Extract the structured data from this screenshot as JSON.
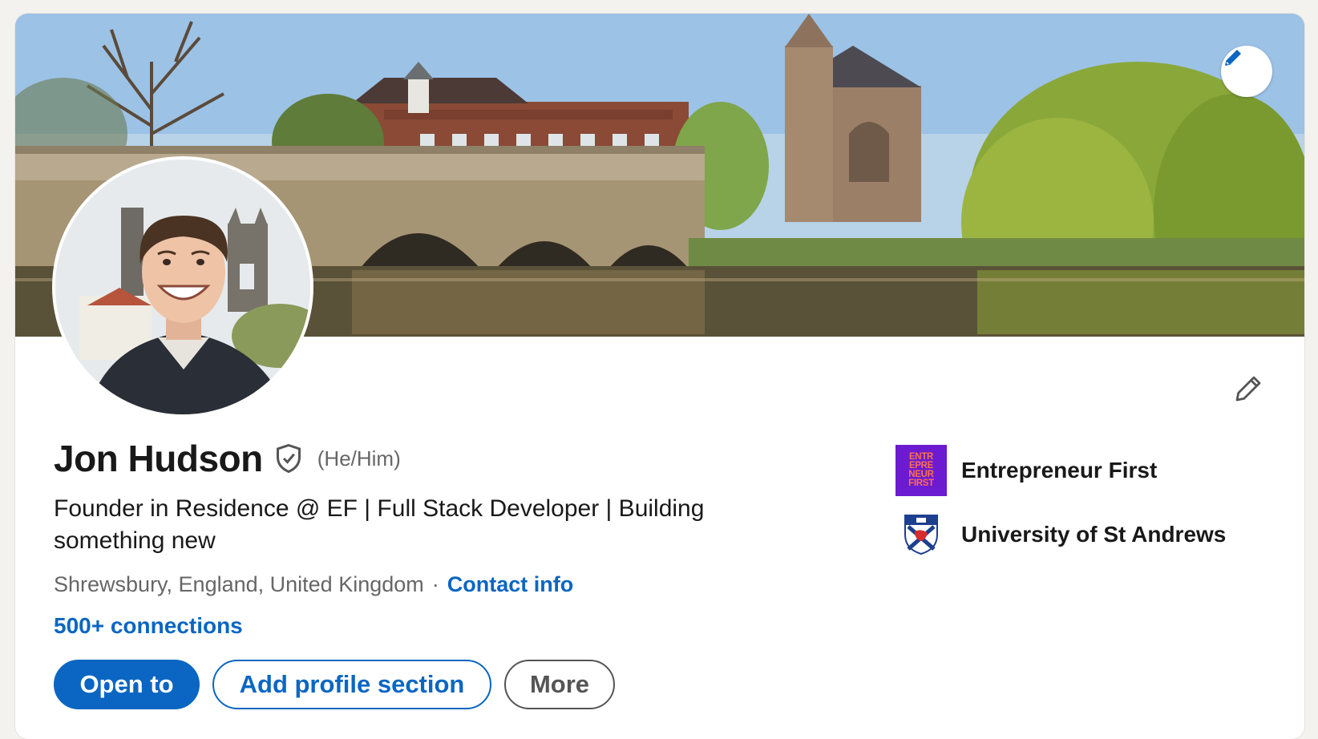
{
  "profile": {
    "name": "Jon Hudson",
    "pronouns": "(He/Him)",
    "headline": "Founder in Residence @ EF | Full Stack Developer | Building something new",
    "location": "Shrewsbury, England, United Kingdom",
    "separator": "·",
    "contact_info_label": "Contact info",
    "connections_label": "500+ connections",
    "verified": true
  },
  "actions": {
    "open_to": "Open to",
    "add_section": "Add profile section",
    "more": "More"
  },
  "organizations": [
    {
      "name": "Entrepreneur First",
      "logo_text": [
        "ENTR",
        "EPRE",
        "NEUR",
        "FIRST"
      ],
      "logo_bg": "#6c1bd1",
      "logo_fg": "#ff6e4f"
    },
    {
      "name": "University of St Andrews"
    }
  ],
  "icons": {
    "banner_edit": "pencil-icon",
    "intro_edit": "pencil-outline-icon",
    "verified": "shield-check-icon"
  },
  "colors": {
    "brand_blue": "#0a66c2",
    "text_primary": "#191919",
    "text_secondary": "#666666"
  }
}
